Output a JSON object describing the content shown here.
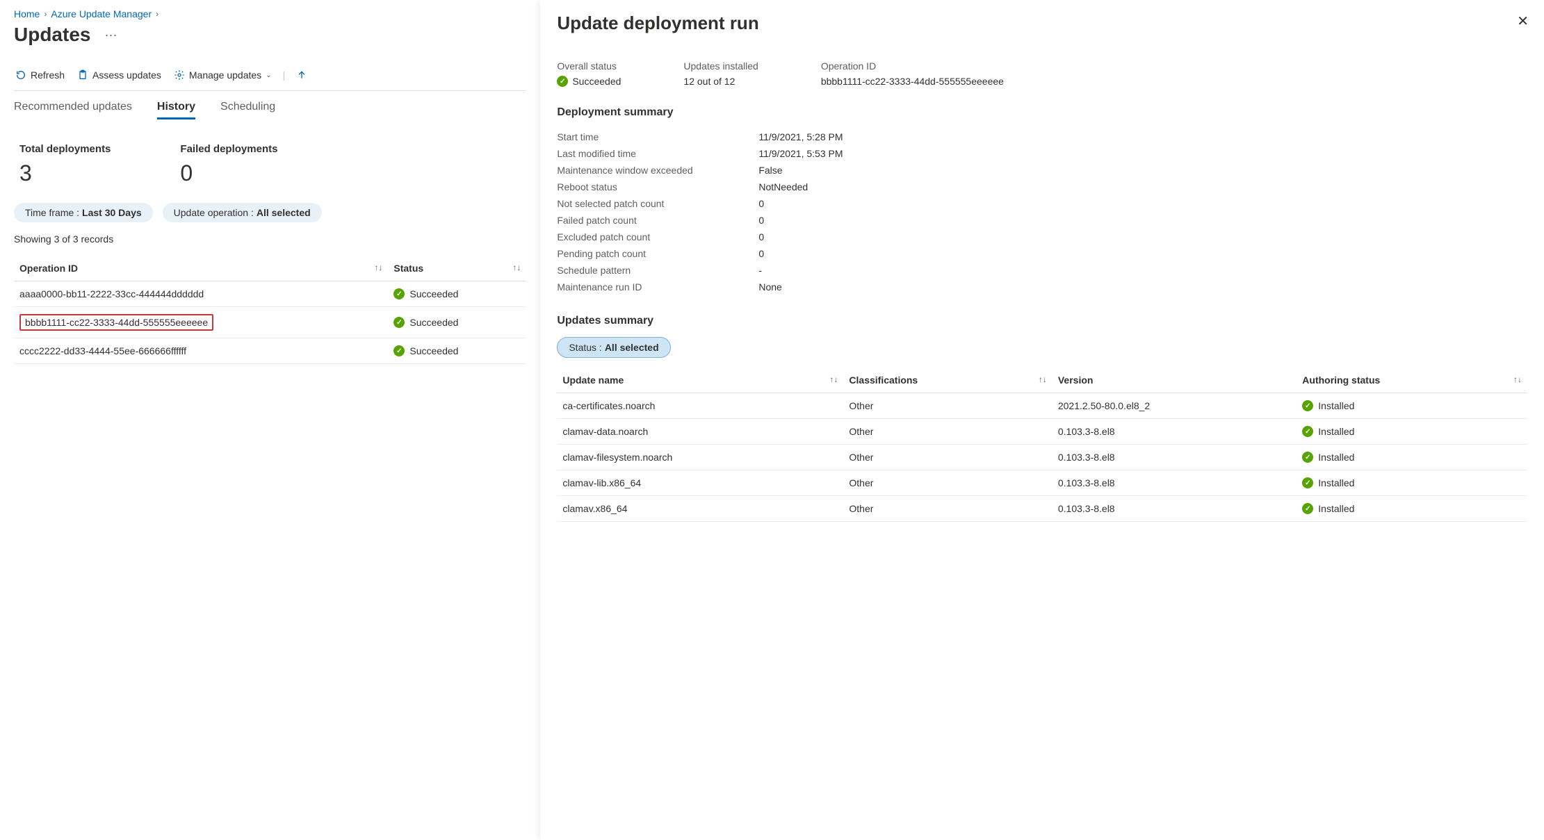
{
  "breadcrumbs": {
    "home": "Home",
    "service": "Azure Update Manager"
  },
  "page_title": "Updates",
  "toolbar": {
    "refresh": "Refresh",
    "assess": "Assess updates",
    "manage": "Manage updates"
  },
  "tabs": {
    "recommended": "Recommended updates",
    "history": "History",
    "scheduling": "Scheduling"
  },
  "stats": {
    "total_label": "Total deployments",
    "total_value": "3",
    "failed_label": "Failed deployments",
    "failed_value": "0"
  },
  "filters": {
    "timeframe_label": "Time frame : ",
    "timeframe_value": "Last 30 Days",
    "operation_label": "Update operation : ",
    "operation_value": "All selected"
  },
  "records_text": "Showing 3 of 3 records",
  "history_table": {
    "headers": {
      "op_id": "Operation ID",
      "status": "Status"
    },
    "rows": [
      {
        "id": "aaaa0000-bb11-2222-33cc-444444dddddd",
        "status": "Succeeded",
        "highlight": false
      },
      {
        "id": "bbbb1111-cc22-3333-44dd-555555eeeeee",
        "status": "Succeeded",
        "highlight": true
      },
      {
        "id": "cccc2222-dd33-4444-55ee-666666ffffff",
        "status": "Succeeded",
        "highlight": false
      }
    ]
  },
  "panel": {
    "title": "Update deployment run",
    "overview": {
      "overall_label": "Overall status",
      "overall_value": "Succeeded",
      "installed_label": "Updates installed",
      "installed_value": "12 out of 12",
      "opid_label": "Operation ID",
      "opid_value": "bbbb1111-cc22-3333-44dd-555555eeeeee"
    },
    "deployment_summary_title": "Deployment summary",
    "deployment_rows": [
      {
        "k": "Start time",
        "v": "11/9/2021, 5:28 PM"
      },
      {
        "k": "Last modified time",
        "v": "11/9/2021, 5:53 PM"
      },
      {
        "k": "Maintenance window exceeded",
        "v": "False"
      },
      {
        "k": "Reboot status",
        "v": "NotNeeded"
      },
      {
        "k": "Not selected patch count",
        "v": "0"
      },
      {
        "k": "Failed patch count",
        "v": "0"
      },
      {
        "k": "Excluded patch count",
        "v": "0"
      },
      {
        "k": "Pending patch count",
        "v": "0"
      },
      {
        "k": "Schedule pattern",
        "v": "-"
      },
      {
        "k": "Maintenance run ID",
        "v": "None"
      }
    ],
    "updates_summary_title": "Updates summary",
    "status_filter_label": "Status : ",
    "status_filter_value": "All selected",
    "updates_headers": {
      "name": "Update name",
      "class": "Classifications",
      "version": "Version",
      "auth": "Authoring status"
    },
    "updates_rows": [
      {
        "name": "ca-certificates.noarch",
        "class": "Other",
        "version": "2021.2.50-80.0.el8_2",
        "auth": "Installed"
      },
      {
        "name": "clamav-data.noarch",
        "class": "Other",
        "version": "0.103.3-8.el8",
        "auth": "Installed"
      },
      {
        "name": "clamav-filesystem.noarch",
        "class": "Other",
        "version": "0.103.3-8.el8",
        "auth": "Installed"
      },
      {
        "name": "clamav-lib.x86_64",
        "class": "Other",
        "version": "0.103.3-8.el8",
        "auth": "Installed"
      },
      {
        "name": "clamav.x86_64",
        "class": "Other",
        "version": "0.103.3-8.el8",
        "auth": "Installed"
      }
    ]
  }
}
